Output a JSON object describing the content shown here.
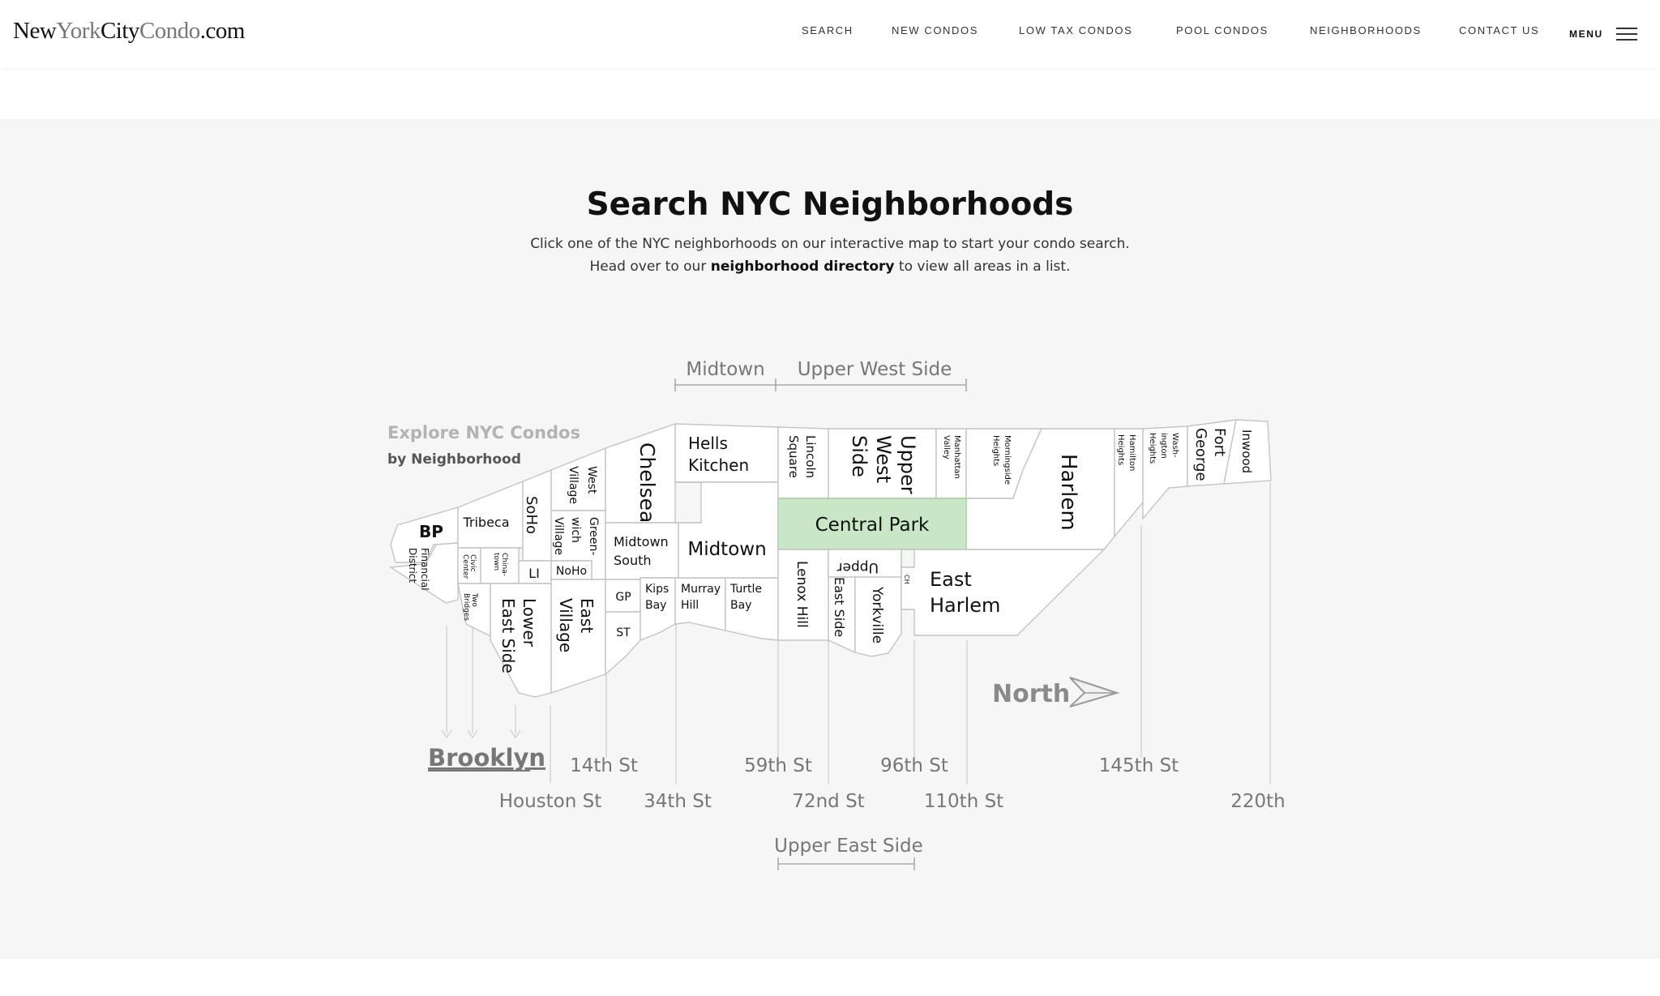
{
  "header": {
    "logo": {
      "part1": "New",
      "part2": "York",
      "part3": "City",
      "part4": "Condo",
      "part5": ".com"
    },
    "nav": [
      {
        "label": "SEARCH"
      },
      {
        "label": "NEW CONDOS"
      },
      {
        "label": "LOW TAX CONDOS"
      },
      {
        "label": "POOL CONDOS"
      },
      {
        "label": "NEIGHBORHOODS"
      },
      {
        "label": "CONTACT US"
      }
    ],
    "menu_label": "MENU"
  },
  "section": {
    "title": "Search NYC Neighborhoods",
    "line1": "Click one of the NYC neighborhoods on our interactive map to start your condo search.",
    "line2_pre": "Head over to our ",
    "line2_link": "neighborhood directory",
    "line2_post": " to view all areas in a list."
  },
  "map": {
    "explore_title": "Explore NYC Condos",
    "explore_sub": "by Neighborhood",
    "region_labels": {
      "midtown": "Midtown",
      "upper_west_side": "Upper West Side",
      "upper_east_side": "Upper East Side"
    },
    "north_label": "North",
    "brooklyn_label": "Brooklyn",
    "streets": {
      "s14": "14th St",
      "houston": "Houston St",
      "s34": "34th St",
      "s59": "59th St",
      "s72": "72nd St",
      "s96": "96th St",
      "s110": "110th St",
      "s145": "145th St",
      "s220": "220th"
    },
    "neighborhoods": {
      "bp": "BP",
      "financial_1": "Financial",
      "financial_2": "District",
      "tribeca": "Tribeca",
      "soho": "SoHo",
      "civic_1": "Civic",
      "civic_2": "Center",
      "china_1": "China-",
      "china_2": "town",
      "li": "LI",
      "two_1": "Two",
      "two_2": "Bridges",
      "les_1": "Lower",
      "les_2": "East Side",
      "wv_1": "West",
      "wv_2": "Village",
      "gv_1": "Green-",
      "gv_2": "wich",
      "gv_3": "Village",
      "noho": "NoHo",
      "ev_1": "East",
      "ev_2": "Village",
      "chelsea": "Chelsea",
      "ms_1": "Midtown",
      "ms_2": "South",
      "gp": "GP",
      "st": "ST",
      "kips_1": "Kips",
      "kips_2": "Bay",
      "murray_1": "Murray",
      "murray_2": "Hill",
      "turtle_1": "Turtle",
      "turtle_2": "Bay",
      "hk_1": "Hells",
      "hk_2": "Kitchen",
      "midtown": "Midtown",
      "lincoln_1": "Lincoln",
      "lincoln_2": "Square",
      "uws_1": "Upper",
      "uws_2": "West",
      "uws_3": "Side",
      "mv_1": "Manhattan",
      "mv_2": "Valley",
      "mh_1": "Morningside",
      "mh_2": "Heights",
      "harlem": "Harlem",
      "central_park": "Central Park",
      "lenox": "Lenox Hill",
      "ues_1": "Upper",
      "ues_2": "East Side",
      "yorkville": "Yorkville",
      "ch": "CH",
      "eh_1": "East",
      "eh_2": "Harlem",
      "hh_1": "Hamilton",
      "hh_2": "Heights",
      "wh_1": "Wash-",
      "wh_2": "ington",
      "wh_3": "Heights",
      "fg_1": "Fort",
      "fg_2": "George",
      "inwood": "Inwood"
    }
  }
}
